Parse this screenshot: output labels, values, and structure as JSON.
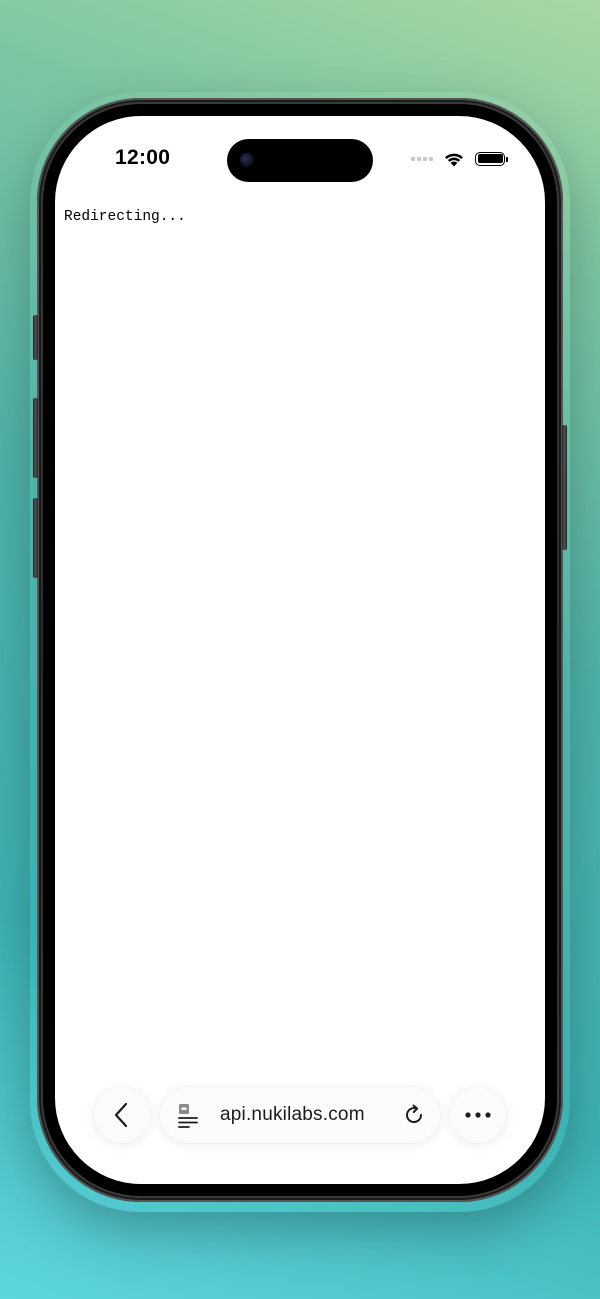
{
  "status_bar": {
    "time": "12:00",
    "icons": [
      "cellular-signal-icon",
      "wifi-icon",
      "battery-icon"
    ]
  },
  "page": {
    "body_text": "Redirecting..."
  },
  "browser_toolbar": {
    "back_icon": "chevron-left-icon",
    "page_icon": "reader-page-icon",
    "url": "api.nukilabs.com",
    "reload_icon": "reload-icon",
    "more_icon": "ellipsis-icon"
  },
  "colors": {
    "background_top": "#a8d8a4",
    "background_bottom": "#5ed6dd",
    "screen": "#ffffff",
    "toolbar_pill": "#fbfbfb"
  }
}
